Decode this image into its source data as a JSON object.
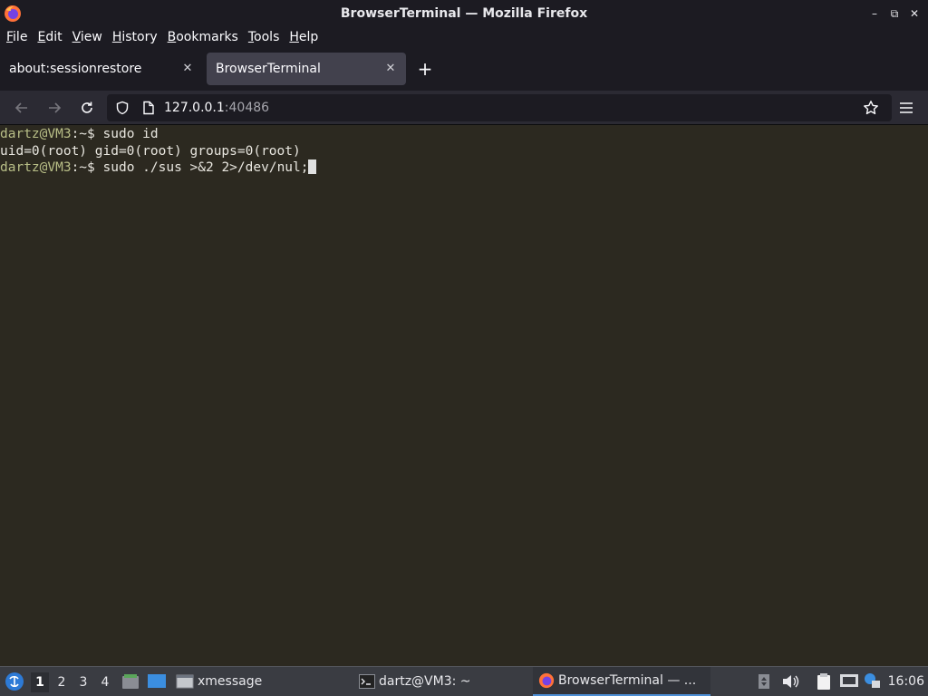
{
  "window": {
    "title": "BrowserTerminal — Mozilla Firefox",
    "controls": {
      "minimize": "–",
      "restore": "⧉",
      "close": "✕"
    }
  },
  "menu": [
    "File",
    "Edit",
    "View",
    "History",
    "Bookmarks",
    "Tools",
    "Help"
  ],
  "tabs": [
    {
      "label": "about:sessionrestore",
      "close": "✕",
      "active": false
    },
    {
      "label": "BrowserTerminal",
      "close": "✕",
      "active": true
    }
  ],
  "new_tab_label": "+",
  "navbar": {
    "url_host": "127.0.0.1",
    "url_port": ":40486",
    "icons": [
      "back-icon",
      "forward-icon",
      "reload-icon",
      "shield-icon",
      "page-icon",
      "star-icon",
      "hamburger-menu-icon"
    ]
  },
  "terminal": {
    "lines": [
      {
        "prompt": "dartz@VM3",
        "sep": ":~$",
        "cmd": " sudo id"
      },
      {
        "output": "uid=0(root) gid=0(root) groups=0(root)"
      },
      {
        "prompt": "dartz@VM3",
        "sep": ":~$",
        "cmd": " sudo ./sus >&2 2>/dev/nul;"
      }
    ]
  },
  "taskbar": {
    "workspaces": [
      "1",
      "2",
      "3",
      "4"
    ],
    "active_workspace": "1",
    "tasks": [
      {
        "label": "xmessage",
        "icon": "window-icon"
      },
      {
        "label": "dartz@VM3: ~",
        "icon": "terminal-icon"
      },
      {
        "label": "BrowserTerminal — ...",
        "icon": "firefox-icon",
        "active": true
      }
    ],
    "clock": "16:06"
  },
  "colors": {
    "terminal_bg": "#2c2920",
    "prompt": "#b9bf87",
    "accent": "#4d8fd6"
  }
}
